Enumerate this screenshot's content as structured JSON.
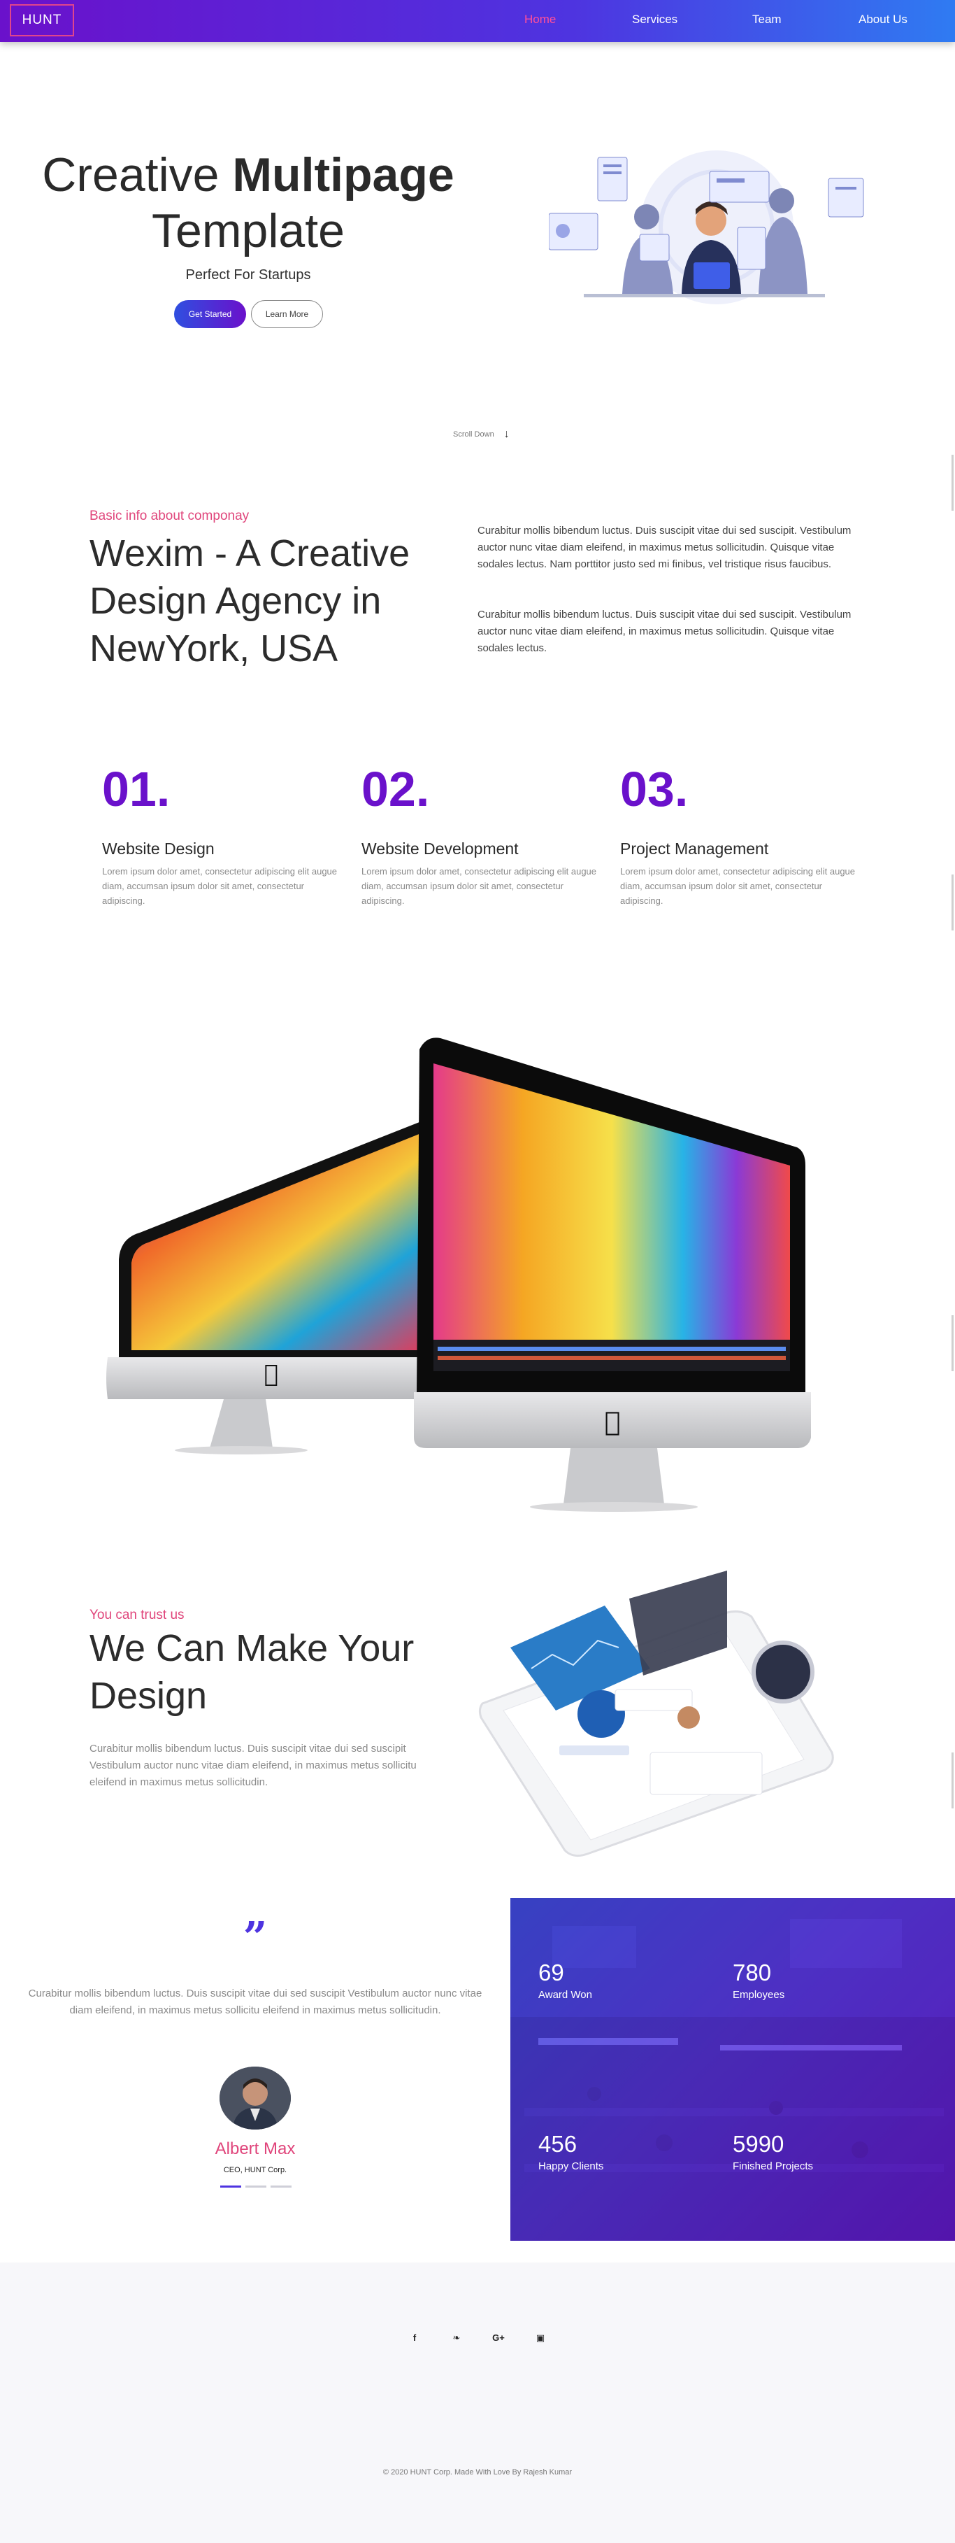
{
  "nav": {
    "brand": "HUNT",
    "links": [
      "Home",
      "Services",
      "Team",
      "About Us"
    ]
  },
  "hero": {
    "title_light": "Creative ",
    "title_bold": "Multipage",
    "title_line2": "Template",
    "subtitle": "Perfect For Startups",
    "primary_btn": "Get Started",
    "secondary_btn": "Learn More",
    "scroll_label": "Scroll Down"
  },
  "about": {
    "kicker": "Basic info about componay",
    "title": "Wexim - A Creative Design Agency in NewYork, USA",
    "para1": "Curabitur mollis bibendum luctus. Duis suscipit vitae dui sed suscipit. Vestibulum auctor nunc vitae diam eleifend, in maximus metus sollicitudin. Quisque vitae sodales lectus. Nam porttitor justo sed mi finibus, vel tristique risus faucibus.",
    "para2": "Curabitur mollis bibendum luctus. Duis suscipit vitae dui sed suscipit. Vestibulum auctor nunc vitae diam eleifend, in maximus metus sollicitudin. Quisque vitae sodales lectus."
  },
  "features": [
    {
      "num": "01.",
      "title": "Website Design",
      "desc": "Lorem ipsum dolor amet, consectetur adipiscing elit augue diam, accumsan ipsum dolor sit amet, consectetur adipiscing."
    },
    {
      "num": "02.",
      "title": "Website Development",
      "desc": "Lorem ipsum dolor amet, consectetur adipiscing elit augue diam, accumsan ipsum dolor sit amet, consectetur adipiscing."
    },
    {
      "num": "03.",
      "title": "Project Management",
      "desc": "Lorem ipsum dolor amet, consectetur adipiscing elit augue diam, accumsan ipsum dolor sit amet, consectetur adipiscing."
    }
  ],
  "trust": {
    "kicker": "You can trust us",
    "title": "We Can Make Your Design",
    "desc": "Curabitur mollis bibendum luctus. Duis suscipit vitae dui sed suscipit Vestibulum auctor nunc vitae diam eleifend, in maximus metus sollicitu eleifend in maximus metus sollicitudin."
  },
  "testimonial": {
    "quote_mark": "”",
    "text": "Curabitur mollis bibendum luctus. Duis suscipit vitae dui sed suscipit Vestibulum auctor nunc vitae diam eleifend, in maximus metus sollicitu eleifend in maximus metus sollicitudin.",
    "name": "Albert Max",
    "role": "CEO, HUNT Corp."
  },
  "stats": [
    {
      "value": "69",
      "label": "Award Won"
    },
    {
      "value": "780",
      "label": "Employees"
    },
    {
      "value": "456",
      "label": "Happy Clients"
    },
    {
      "value": "5990",
      "label": "Finished Projects"
    }
  ],
  "footer": {
    "social_icons": [
      "facebook-icon",
      "twitter-icon",
      "google-plus-icon",
      "instagram-icon"
    ],
    "social_glyphs": [
      "f",
      "❧",
      "G+",
      "▣"
    ],
    "copyright": "© 2020 HUNT Corp. Made With Love By Rajesh Kumar"
  },
  "colors": {
    "brand_purple": "#6a11cb",
    "brand_blue": "#2f7bf2",
    "accent_pink": "#e0457b"
  }
}
